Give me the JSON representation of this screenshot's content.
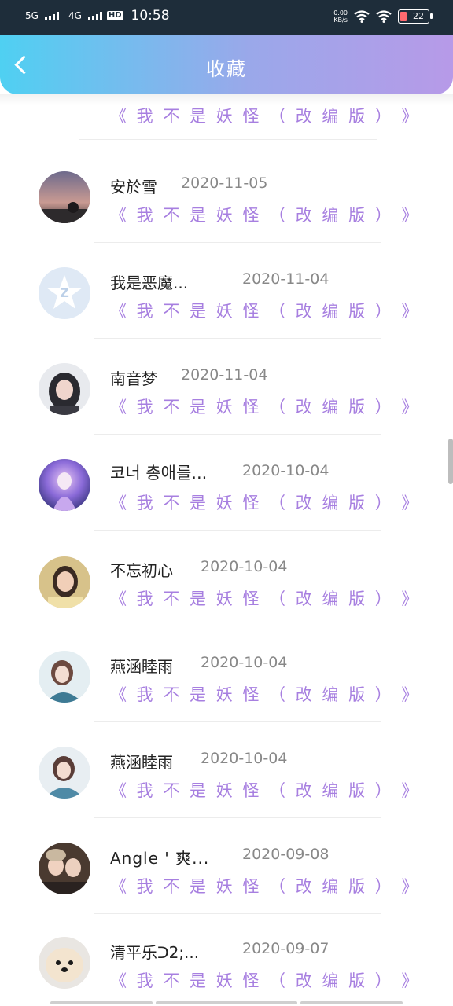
{
  "status_bar": {
    "network1": "5G",
    "network2": "4G",
    "hd": "HD",
    "time": "10:58",
    "speed_value": "0.00",
    "speed_unit": "KB/s",
    "battery": "22"
  },
  "header": {
    "title": "收藏"
  },
  "list": [
    {
      "user": "",
      "date": "",
      "title": "《 我 不 是 妖 怪 （ 改 编 版 ） 》"
    },
    {
      "user": "安於雪",
      "date": "2020-11-05",
      "title": "《 我 不 是 妖 怪 （ 改 编 版 ） 》"
    },
    {
      "user": "我是恶魔...",
      "date": "2020-11-04",
      "title": "《 我 不 是 妖 怪 （ 改 编 版 ） 》"
    },
    {
      "user": "南音梦",
      "date": "2020-11-04",
      "title": "《 我 不 是 妖 怪 （ 改 编 版 ） 》"
    },
    {
      "user": "코너 총애를...",
      "date": "2020-10-04",
      "title": "《 我 不 是 妖 怪 （ 改 编 版 ） 》"
    },
    {
      "user": "不忘初心",
      "date": "2020-10-04",
      "title": "《 我 不 是 妖 怪 （ 改 编 版 ） 》"
    },
    {
      "user": "燕涵睦雨",
      "date": "2020-10-04",
      "title": "《 我 不 是 妖 怪 （ 改 编 版 ） 》"
    },
    {
      "user": "燕涵睦雨",
      "date": "2020-10-04",
      "title": "《 我 不 是 妖 怪 （ 改 编 版 ） 》"
    },
    {
      "user": "Angle ' 爽...",
      "date": "2020-09-08",
      "title": "《 我 不 是 妖 怪 （ 改 编 版 ） 》"
    },
    {
      "user": "清平乐ᑐ2;...",
      "date": "2020-09-07",
      "title": "《 我 不 是 妖 怪 （ 改 编 版 ） 》"
    }
  ],
  "colors": {
    "accent": "#a77fe0",
    "header_start": "#4fd0f2",
    "header_end": "#b79ae8"
  }
}
